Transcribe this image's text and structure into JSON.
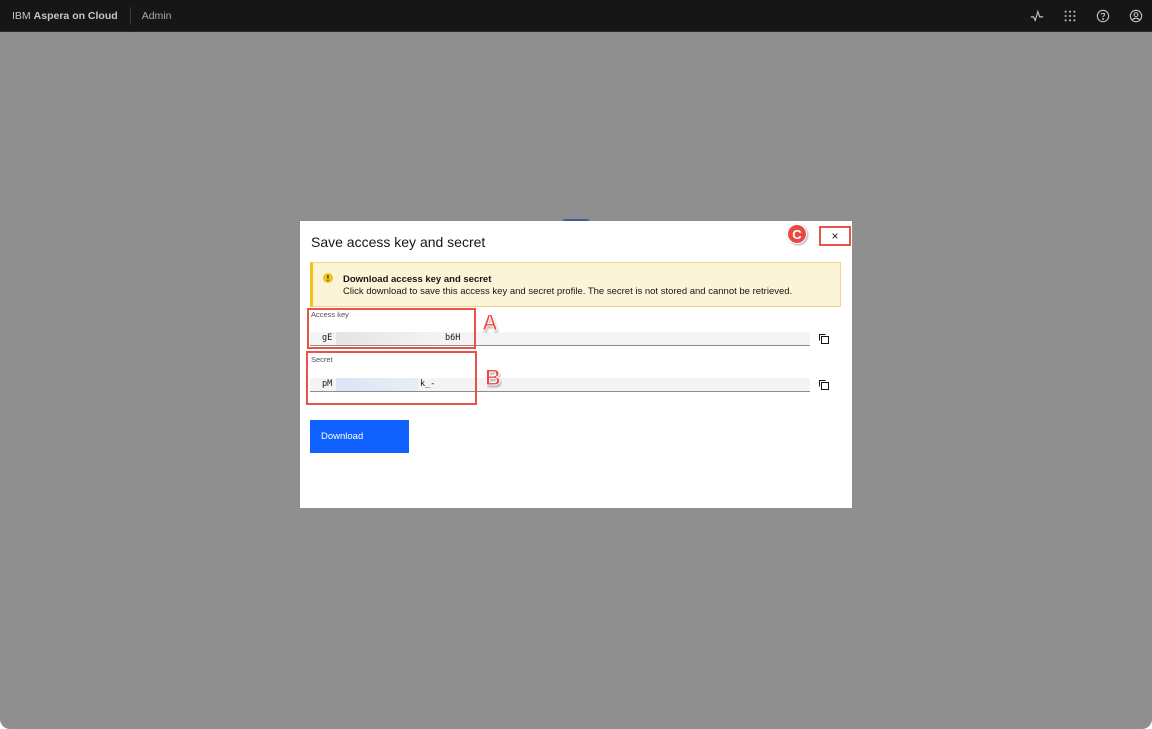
{
  "header": {
    "brand_prefix": "IBM",
    "brand_name": "Aspera on Cloud",
    "section": "Admin",
    "icons": [
      "activity-icon",
      "app-switcher-icon",
      "help-icon",
      "user-profile-icon"
    ]
  },
  "modal": {
    "title": "Save access key and secret",
    "close_label": "×",
    "notice": {
      "icon": "warning-icon",
      "title": "Download access key and secret",
      "body": "Click download to save this access key and secret profile. The secret is not stored and cannot be retrieved."
    },
    "fields": [
      {
        "label": "Access key",
        "value_start": "gE",
        "value_end": "b6H",
        "redacted": true,
        "copy_icon": "copy-icon"
      },
      {
        "label": "Secret",
        "value_start": "pM",
        "value_end": "k_-",
        "redacted": true,
        "copy_icon": "copy-icon"
      }
    ],
    "download_label": "Download"
  },
  "annotations": {
    "callout_a": "A",
    "callout_b": "B",
    "callout_c": "C",
    "highlight_color": "#e8524b"
  },
  "colors": {
    "primary": "#0f62fe",
    "warning_bg": "#fcf4d6",
    "warning_accent": "#f1c21b",
    "topbar_bg": "#161616",
    "overlay": "#8f8f8f"
  }
}
